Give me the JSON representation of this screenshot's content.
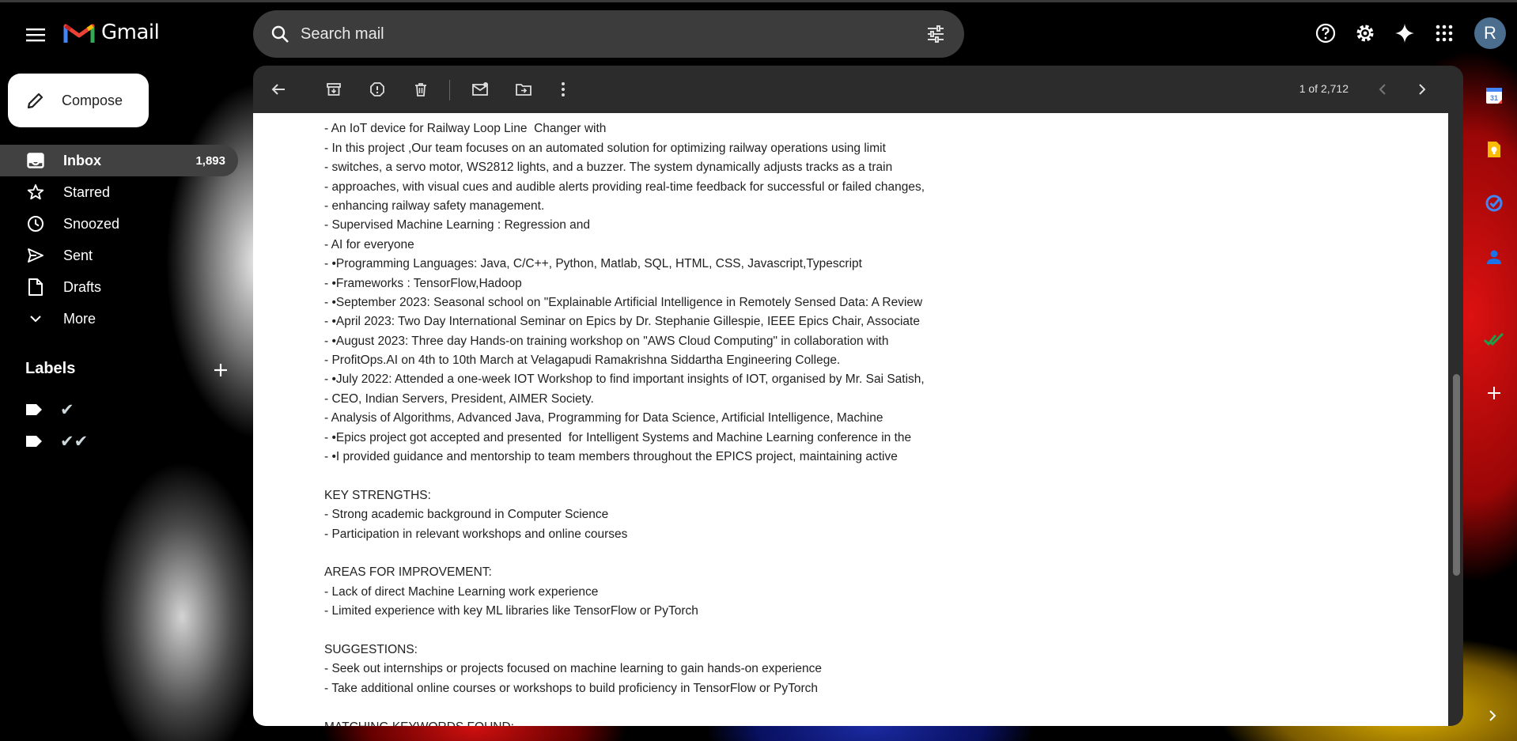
{
  "app": {
    "logo_text": "Gmail"
  },
  "search": {
    "placeholder": "Search mail"
  },
  "topbar": {
    "avatar_initial": "R"
  },
  "compose": {
    "label": "Compose"
  },
  "nav": {
    "items": [
      {
        "label": "Inbox",
        "count": "1,893"
      },
      {
        "label": "Starred"
      },
      {
        "label": "Snoozed"
      },
      {
        "label": "Sent"
      },
      {
        "label": "Drafts"
      },
      {
        "label": "More"
      }
    ]
  },
  "labels": {
    "heading": "Labels",
    "items": [
      {
        "name": "✔"
      },
      {
        "name": "✔✔"
      }
    ]
  },
  "toolbar": {
    "pager": "1 of 2,712"
  },
  "email": {
    "lines": [
      "",
      "- An IoT device for Railway Loop Line  Changer with",
      "- In this project ,Our team focuses on an automated solution for optimizing railway operations using limit",
      "- switches, a servo motor, WS2812 lights, and a buzzer. The system dynamically adjusts tracks as a train",
      "- approaches, with visual cues and audible alerts providing real-time feedback for successful or failed changes,",
      "- enhancing railway safety management.",
      "- Supervised Machine Learning : Regression and",
      "- AI for everyone",
      "- •Programming Languages: Java, C/C++, Python, Matlab, SQL, HTML, CSS, Javascript,Typescript",
      "- •Frameworks : TensorFlow,Hadoop",
      "- •September 2023: Seasonal school on \"Explainable Artificial Intelligence in Remotely Sensed Data: A Review",
      "- •April 2023: Two Day International Seminar on Epics by Dr. Stephanie Gillespie, IEEE Epics Chair, Associate",
      "- •August 2023: Three day Hands-on training workshop on \"AWS Cloud Computing\" in collaboration with",
      "- ProfitOps.AI on 4th to 10th March at Velagapudi Ramakrishna Siddartha Engineering College.",
      "- •July 2022: Attended a one-week IOT Workshop to find important insights of IOT, organised by Mr. Sai Satish,",
      "- CEO, Indian Servers, President, AIMER Society.",
      "- Analysis of Algorithms, Advanced Java, Programming for Data Science, Artificial Intelligence, Machine",
      "- •Epics project got accepted and presented  for Intelligent Systems and Machine Learning conference in the",
      "- •I provided guidance and mentorship to team members throughout the EPICS project, maintaining active",
      "",
      "KEY STRENGTHS:",
      "- Strong academic background in Computer Science",
      "- Participation in relevant workshops and online courses",
      "",
      "AREAS FOR IMPROVEMENT:",
      "- Lack of direct Machine Learning work experience",
      "- Limited experience with key ML libraries like TensorFlow or PyTorch",
      "",
      "SUGGESTIONS:",
      "- Seek out internships or projects focused on machine learning to gain hands-on experience",
      "- Take additional online courses or workshops to build proficiency in TensorFlow or PyTorch",
      "",
      "MATCHING KEYWORDS FOUND:"
    ]
  },
  "right_rail": {
    "calendar_day": "31"
  },
  "colors": {
    "background": "#000000",
    "panel_toolbar": "#2c2c2c",
    "active_nav": "#414141",
    "content_bg": "#ffffff"
  }
}
